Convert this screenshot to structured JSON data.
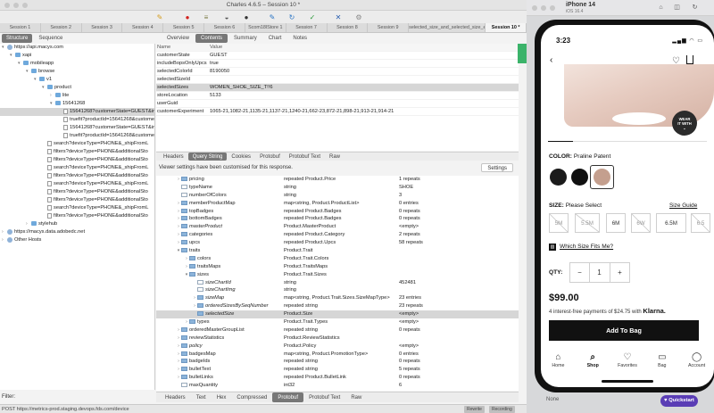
{
  "window": {
    "title": "Charles 4.6.5 – Session 10 *"
  },
  "session_tabs": [
    "Session 1",
    "Session 2",
    "Session 3",
    "Session 4",
    "Session 5",
    "Session 6",
    "Scom18lStore 1",
    "Session 7",
    "Session 8",
    "Session 9",
    "selected_size_and_selected_size_err",
    "Session 10 *"
  ],
  "left_tabs": [
    "Structure",
    "Sequence"
  ],
  "tree": [
    {
      "label": "https://api.macys.com",
      "indent": 0,
      "icon": "globe",
      "disc": "▾"
    },
    {
      "label": "xapi",
      "indent": 1,
      "icon": "folder",
      "disc": "▾"
    },
    {
      "label": "mobileapp",
      "indent": 2,
      "icon": "folder",
      "disc": "▾"
    },
    {
      "label": "browse",
      "indent": 3,
      "icon": "folder",
      "disc": "▾"
    },
    {
      "label": "v1",
      "indent": 4,
      "icon": "folder",
      "disc": "▾"
    },
    {
      "label": "product",
      "indent": 5,
      "icon": "folder",
      "disc": "▾"
    },
    {
      "label": "lite",
      "indent": 6,
      "icon": "folder",
      "disc": "›"
    },
    {
      "label": "15641268",
      "indent": 6,
      "icon": "folder",
      "disc": "▾"
    },
    {
      "label": "15641268?customerState=GUEST&in",
      "indent": 7,
      "icon": "file",
      "disc": "",
      "sel": true
    },
    {
      "label": "truefit?productId=15641268&custome",
      "indent": 7,
      "icon": "file",
      "disc": ""
    },
    {
      "label": "15641268?customerState=GUEST&in",
      "indent": 7,
      "icon": "file",
      "disc": ""
    },
    {
      "label": "truefit?productId=15641268&custome",
      "indent": 7,
      "icon": "file",
      "disc": ""
    },
    {
      "label": "search?deviceType=PHONE&_shipFromL",
      "indent": 5,
      "icon": "file",
      "disc": ""
    },
    {
      "label": "filters?deviceType=PHONE&additionalSto",
      "indent": 5,
      "icon": "file",
      "disc": ""
    },
    {
      "label": "filters?deviceType=PHONE&additionalSto",
      "indent": 5,
      "icon": "file",
      "disc": ""
    },
    {
      "label": "search?deviceType=PHONE&_shipFromL",
      "indent": 5,
      "icon": "file",
      "disc": ""
    },
    {
      "label": "filters?deviceType=PHONE&additionalSto",
      "indent": 5,
      "icon": "file",
      "disc": ""
    },
    {
      "label": "search?deviceType=PHONE&_shipFromL",
      "indent": 5,
      "icon": "file",
      "disc": ""
    },
    {
      "label": "filters?deviceType=PHONE&additionalSto",
      "indent": 5,
      "icon": "file",
      "disc": ""
    },
    {
      "label": "filters?deviceType=PHONE&additionalSto",
      "indent": 5,
      "icon": "file",
      "disc": ""
    },
    {
      "label": "search?deviceType=PHONE&_shipFromL",
      "indent": 5,
      "icon": "file",
      "disc": ""
    },
    {
      "label": "filters?deviceType=PHONE&additionalSto",
      "indent": 5,
      "icon": "file",
      "disc": ""
    },
    {
      "label": "stylehub",
      "indent": 3,
      "icon": "folder",
      "disc": "›"
    },
    {
      "label": "https://macys.data.adobedc.net",
      "indent": 0,
      "icon": "globe",
      "disc": "›"
    },
    {
      "label": "Other Hosts",
      "indent": 0,
      "icon": "globe",
      "disc": "›"
    }
  ],
  "filter": {
    "label": "Filter:"
  },
  "right_tabs": [
    "Overview",
    "Contents",
    "Summary",
    "Chart",
    "Notes"
  ],
  "overview": {
    "headers": {
      "name": "Name",
      "value": "Value"
    },
    "rows": [
      {
        "name": "customerState",
        "value": "GUEST"
      },
      {
        "name": "includeBopsOnlyUpcs",
        "value": "true"
      },
      {
        "name": "selectedColorId",
        "value": "8190050"
      },
      {
        "name": "selectedSizeId",
        "value": ""
      },
      {
        "name": "selectedSizes",
        "value": "WOMEN_SHOE_SIZE_T!!6",
        "sel": true
      },
      {
        "name": "storeLocation",
        "value": "5133"
      },
      {
        "name": "userGuid",
        "value": ""
      },
      {
        "name": "customerExperiment",
        "value": "1065-21,1082-21,1135-21,1137-21,1240-21,662-23,872-21,898-21,913-21,914-21"
      }
    ]
  },
  "mid_tabs": [
    "Headers",
    "Query String",
    "Cookies",
    "Protobuf",
    "Protobuf Text",
    "Raw"
  ],
  "notice": {
    "text": "Viewer settings have been customised for this response.",
    "button": "Settings"
  },
  "grid": [
    {
      "f": "pricing",
      "t": "repeated Product.Price",
      "v": "1 repeats",
      "i": 1,
      "d": "›"
    },
    {
      "f": "typeName",
      "t": "string",
      "v": "SHOE",
      "i": 1,
      "d": "",
      "leaf": true
    },
    {
      "f": "numberOfColors",
      "t": "string",
      "v": "3",
      "i": 1,
      "d": "",
      "leaf": true
    },
    {
      "f": "memberProductMap",
      "t": "map<string, Product.ProductList>",
      "v": "0 entries",
      "i": 1,
      "d": "›"
    },
    {
      "f": "topBadges",
      "t": "repeated Product.Badges",
      "v": "0 repeats",
      "i": 1,
      "d": "›"
    },
    {
      "f": "bottomBadges",
      "t": "repeated Product.Badges",
      "v": "0 repeats",
      "i": 1,
      "d": "›"
    },
    {
      "f": "masterProduct",
      "t": "Product.MasterProduct",
      "v": "<empty>",
      "i": 1,
      "d": "›"
    },
    {
      "f": "categories",
      "t": "repeated Product.Category",
      "v": "2 repeats",
      "i": 1,
      "d": "›"
    },
    {
      "f": "upcs",
      "t": "repeated Product.Upcs",
      "v": "58 repeats",
      "i": 1,
      "d": "›"
    },
    {
      "f": "traits",
      "t": "Product.Trait",
      "v": "",
      "i": 1,
      "d": "▾"
    },
    {
      "f": "colors",
      "t": "Product.Trait.Colors",
      "v": "",
      "i": 2,
      "d": "›"
    },
    {
      "f": "traitsMaps",
      "t": "Product.TraitsMaps",
      "v": "",
      "i": 2,
      "d": "›"
    },
    {
      "f": "sizes",
      "t": "Product.Trait.Sizes",
      "v": "",
      "i": 2,
      "d": "▾"
    },
    {
      "f": "sizeChartId",
      "t": "string",
      "v": "452481",
      "i": 3,
      "d": "",
      "leaf": true
    },
    {
      "f": "sizeChartImg",
      "t": "string",
      "v": "",
      "i": 3,
      "d": "",
      "leaf": true
    },
    {
      "f": "sizeMap",
      "t": "map<string, Product.Trait.Sizes.SizeMapType>",
      "v": "23 entries",
      "i": 3,
      "d": "›"
    },
    {
      "f": "orderedSizesBySeqNumber",
      "t": "repeated string",
      "v": "23 repeats",
      "i": 3,
      "d": "›"
    },
    {
      "f": "selectedSize",
      "t": "Product.Size",
      "v": "<empty>",
      "i": 3,
      "d": "",
      "sel": true
    },
    {
      "f": "types",
      "t": "Product.Trait.Types",
      "v": "<empty>",
      "i": 2,
      "d": "›"
    },
    {
      "f": "orderedMasterGroupList",
      "t": "repeated string",
      "v": "0 repeats",
      "i": 1,
      "d": "›"
    },
    {
      "f": "reviewStatistics",
      "t": "Product.ReviewStatistics",
      "v": "",
      "i": 1,
      "d": "›"
    },
    {
      "f": "policy",
      "t": "Product.Policy",
      "v": "<empty>",
      "i": 1,
      "d": "›"
    },
    {
      "f": "badgesMap",
      "t": "map<string, Product.PromotionType>",
      "v": "0 entries",
      "i": 1,
      "d": "›"
    },
    {
      "f": "badgeIds",
      "t": "repeated string",
      "v": "0 repeats",
      "i": 1,
      "d": "›"
    },
    {
      "f": "bulletText",
      "t": "repeated string",
      "v": "5 repeats",
      "i": 1,
      "d": "›"
    },
    {
      "f": "bulletLinks",
      "t": "repeated Product.BulletLink",
      "v": "0 repeats",
      "i": 1,
      "d": "›"
    },
    {
      "f": "maxQuantity",
      "t": "int32",
      "v": "6",
      "i": 1,
      "d": "",
      "leaf": true
    }
  ],
  "bottom_tabs": [
    "Headers",
    "Text",
    "Hex",
    "Compressed",
    "Protobuf",
    "Protobuf Text",
    "Raw"
  ],
  "status": {
    "text": "POST https://metrics-prod.staging.devops.fds.com/device",
    "rewrite": "Rewrite",
    "recording": "Recording"
  },
  "simulator": {
    "name": "iPhone 14",
    "os": "iOS 16.4"
  },
  "phone": {
    "time": "3:23",
    "wear_badge_1": "WEAR",
    "wear_badge_2": "IT WITH",
    "color_label": "COLOR:",
    "color_value": "Praline Patent",
    "colors": [
      "#1b1b1b",
      "#101010",
      "#c49f8e"
    ],
    "size_label": "SIZE:",
    "size_value": "Please Select",
    "size_guide": "Size Guide",
    "sizes": [
      {
        "label": "5M",
        "disabled": true
      },
      {
        "label": "5.5M",
        "disabled": true
      },
      {
        "label": "6M",
        "disabled": false
      },
      {
        "label": "6W",
        "disabled": true
      },
      {
        "label": "6.5M",
        "disabled": false
      },
      {
        "label": "6.5",
        "disabled": true
      }
    ],
    "fit_link": "Which Size Fits Me?",
    "qty_label": "QTY:",
    "qty_minus": "−",
    "qty_value": "1",
    "qty_plus": "+",
    "price": "$99.00",
    "installment": "4 interest-free payments of $24.75 with",
    "klarna": "Klarna.",
    "add_to_bag": "Add To Bag",
    "tabs": [
      {
        "label": "Home",
        "glyph": "⌂"
      },
      {
        "label": "Shop",
        "glyph": "⌕",
        "active": true
      },
      {
        "label": "Favorites",
        "glyph": "♡"
      },
      {
        "label": "Bag",
        "glyph": "▭"
      },
      {
        "label": "Account",
        "glyph": "◯"
      }
    ]
  },
  "quickstart": "Quickstart",
  "none_label": "None"
}
